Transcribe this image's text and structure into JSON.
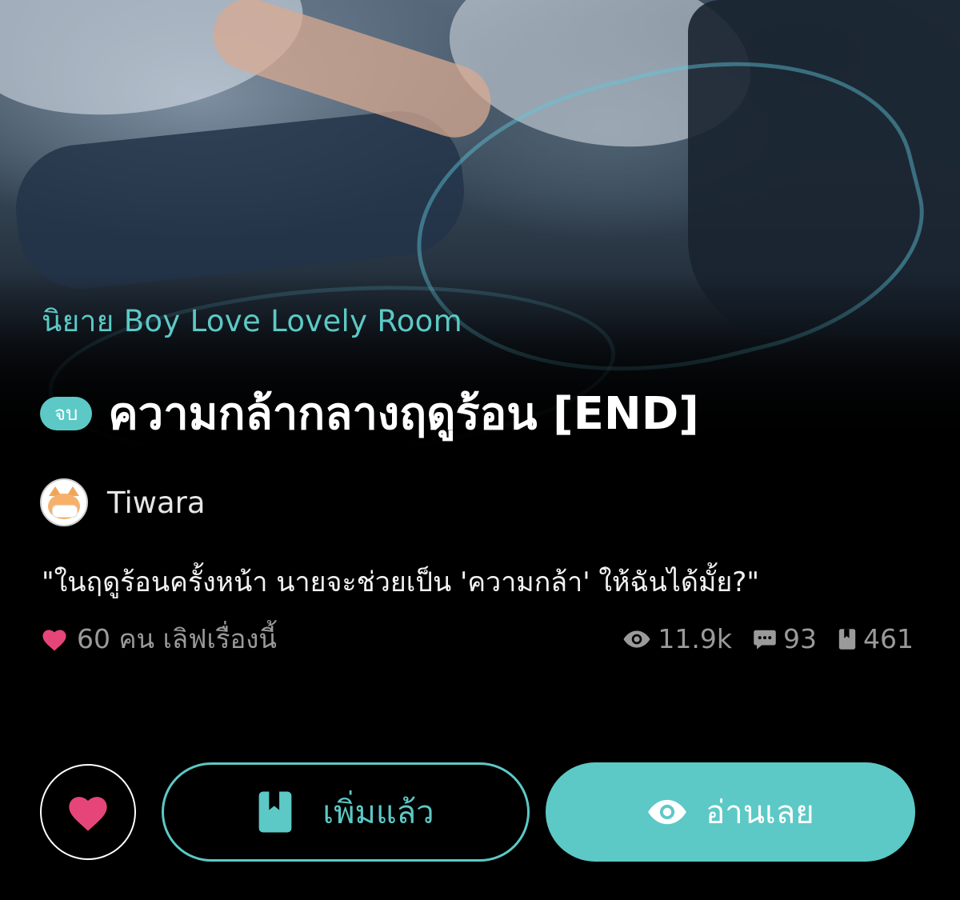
{
  "cover": {
    "alt_icon": "cover-illustration"
  },
  "story": {
    "category": "นิยาย Boy Love Lovely Room",
    "status_badge": "จบ",
    "title": "ความกล้ากลางฤดูร้อน [END]",
    "author": "Tiwara",
    "tagline": "\"ในฤดูร้อนครั้งหน้า นายจะช่วยเป็น 'ความกล้า' ให้ฉันได้มั้ย?\""
  },
  "stats": {
    "likes_text": "60 คน เลิฟเรื่องนี้",
    "views": "11.9k",
    "comments": "93",
    "bookmarks": "461"
  },
  "actions": {
    "added_label": "เพิ่มแล้ว",
    "read_label": "อ่านเลย"
  },
  "colors": {
    "accent": "#5cc9c6",
    "heart": "#e6457a",
    "background": "#000000",
    "muted_text": "#9a9a9a"
  }
}
